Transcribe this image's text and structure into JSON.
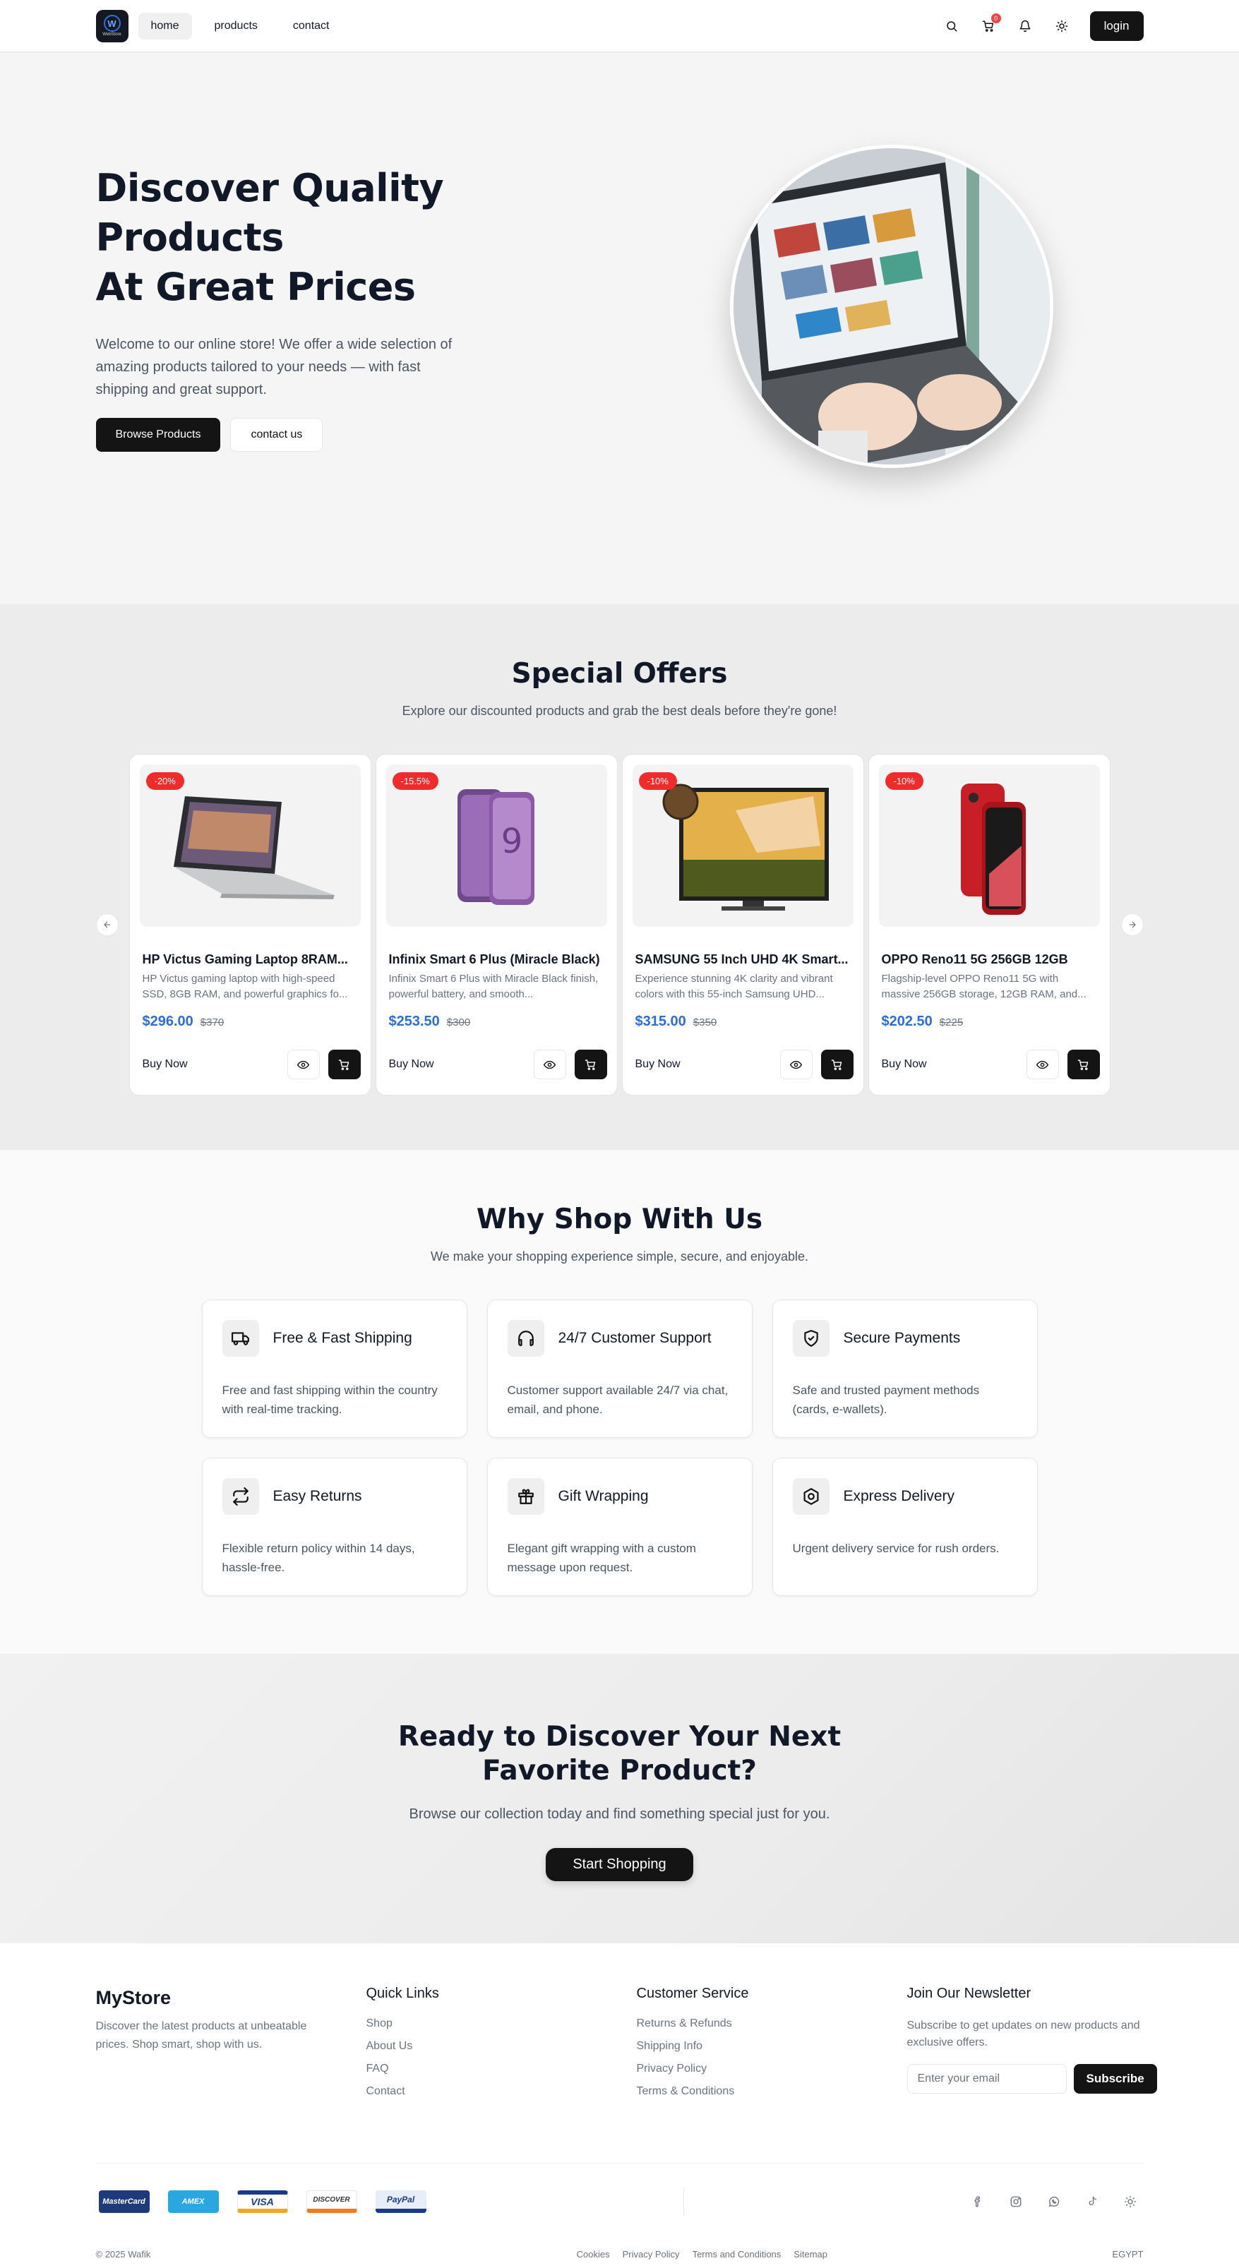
{
  "nav": {
    "logo_text": "WebStore",
    "links": [
      "home",
      "products",
      "contact"
    ],
    "cart_count": "0",
    "login_label": "login"
  },
  "hero": {
    "title_line1": "Discover Quality Products",
    "title_line2": "At Great Prices",
    "description": "Welcome to our online store! We offer a wide selection of amazing products tailored to your needs — with fast shipping and great support.",
    "primary_btn": "Browse Products",
    "secondary_btn": "contact us"
  },
  "offers": {
    "title": "Special Offers",
    "subtitle": "Explore our discounted products and grab the best deals before they're gone!",
    "products": [
      {
        "discount": "-20%",
        "name": "HP Victus Gaming Laptop 8RAM...",
        "description": "HP Victus gaming laptop with high-speed SSD, 8GB RAM, and powerful graphics fo...",
        "price": "$296.00",
        "old_price": "$370",
        "buy_label": "Buy Now"
      },
      {
        "discount": "-15.5%",
        "name": "Infinix Smart 6 Plus (Miracle Black)",
        "description": "Infinix Smart 6 Plus with Miracle Black finish, powerful battery, and smooth...",
        "price": "$253.50",
        "old_price": "$300",
        "buy_label": "Buy Now"
      },
      {
        "discount": "-10%",
        "name": "SAMSUNG 55 Inch UHD 4K Smart...",
        "description": "Experience stunning 4K clarity and vibrant colors with this 55-inch Samsung UHD...",
        "price": "$315.00",
        "old_price": "$350",
        "buy_label": "Buy Now"
      },
      {
        "discount": "-10%",
        "name": "OPPO Reno11 5G 256GB 12GB",
        "description": "Flagship-level OPPO Reno11 5G with massive 256GB storage, 12GB RAM, and...",
        "price": "$202.50",
        "old_price": "$225",
        "buy_label": "Buy Now"
      }
    ]
  },
  "why": {
    "title": "Why Shop With Us",
    "subtitle": "We make your shopping experience simple, secure, and enjoyable.",
    "features": [
      {
        "icon": "truck-icon",
        "title": "Free & Fast Shipping",
        "description": "Free and fast shipping within the country with real-time tracking."
      },
      {
        "icon": "headset-icon",
        "title": "24/7 Customer Support",
        "description": "Customer support available 24/7 via chat, email, and phone."
      },
      {
        "icon": "shield-check-icon",
        "title": "Secure Payments",
        "description": "Safe and trusted payment methods (cards, e-wallets)."
      },
      {
        "icon": "repeat-icon",
        "title": "Easy Returns",
        "description": "Flexible return policy within 14 days, hassle-free."
      },
      {
        "icon": "gift-icon",
        "title": "Gift Wrapping",
        "description": "Elegant gift wrapping with a custom message upon request."
      },
      {
        "icon": "hexagon-icon",
        "title": "Express Delivery",
        "description": "Urgent delivery service for rush orders."
      }
    ]
  },
  "cta": {
    "title": "Ready to Discover Your Next Favorite Product?",
    "subtitle": "Browse our collection today and find something special just for you.",
    "button": "Start Shopping"
  },
  "footer": {
    "brand": "MyStore",
    "brand_desc": "Discover the latest products at unbeatable prices. Shop smart, shop with us.",
    "quick_links_title": "Quick Links",
    "quick_links": [
      "Shop",
      "About Us",
      "FAQ",
      "Contact"
    ],
    "service_title": "Customer Service",
    "service_links": [
      "Returns & Refunds",
      "Shipping Info",
      "Privacy Policy",
      "Terms & Conditions"
    ],
    "newsletter_title": "Join Our Newsletter",
    "newsletter_desc": "Subscribe to get updates on new products and exclusive offers.",
    "email_placeholder": "Enter your email",
    "subscribe_label": "Subscribe",
    "payments": [
      "MasterCard",
      "AMEX",
      "VISA",
      "DISCOVER",
      "PayPal"
    ],
    "copyright": "© 2025 Wafik",
    "bottom_links": [
      "Cookies",
      "Privacy Policy",
      "Terms and Conditions",
      "Sitemap"
    ],
    "country": "EGYPT"
  }
}
